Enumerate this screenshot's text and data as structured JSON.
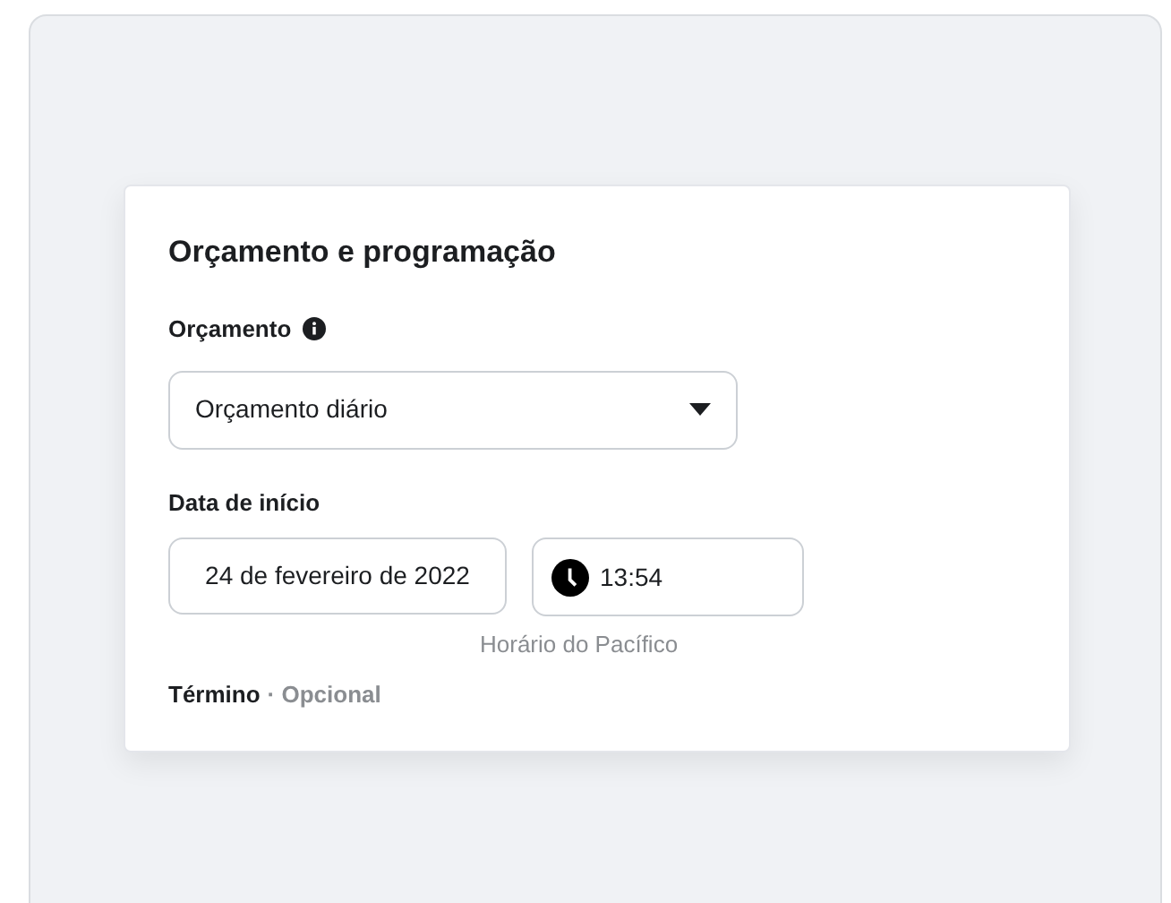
{
  "section_title": "Orçamento e programação",
  "budget": {
    "label": "Orçamento",
    "value": "Orçamento diário"
  },
  "start_date": {
    "label": "Data de início",
    "date": "24 de fevereiro de 2022",
    "time": "13:54",
    "timezone": "Horário do Pacífico"
  },
  "end": {
    "label": "Término",
    "note": "· Opcional"
  }
}
